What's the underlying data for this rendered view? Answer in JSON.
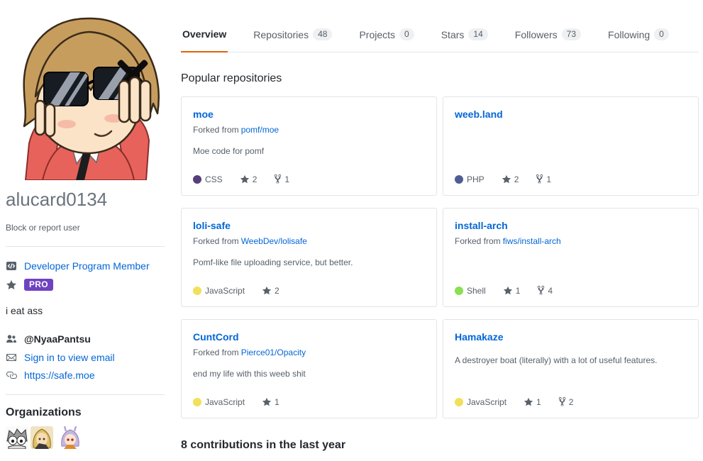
{
  "header_tabs": [
    {
      "label": "Overview",
      "count": null,
      "active": true
    },
    {
      "label": "Repositories",
      "count": "48"
    },
    {
      "label": "Projects",
      "count": "0"
    },
    {
      "label": "Stars",
      "count": "14"
    },
    {
      "label": "Followers",
      "count": "73"
    },
    {
      "label": "Following",
      "count": "0"
    }
  ],
  "sidebar": {
    "username": "alucard0134",
    "block_report_label": "Block or report user",
    "developer_program_label": "Developer Program Member",
    "pro_badge_label": "PRO",
    "bio": "i eat ass",
    "organization_handle": "@NyaaPantsu",
    "email_label": "Sign in to view email",
    "website_url": "https://safe.moe",
    "organizations_title": "Organizations"
  },
  "main": {
    "popular_repositories_title": "Popular repositories",
    "forked_from_prefix": "Forked from",
    "repositories": [
      {
        "name": "moe",
        "forked_from": "pomf/moe",
        "description": "Moe code for pomf",
        "language": "CSS",
        "language_color": "#563d7c",
        "stars": "2",
        "forks": "1"
      },
      {
        "name": "weeb.land",
        "forked_from": "",
        "description": "",
        "language": "PHP",
        "language_color": "#4F5D95",
        "stars": "2",
        "forks": "1"
      },
      {
        "name": "loli-safe",
        "forked_from": "WeebDev/lolisafe",
        "description": "Pomf-like file uploading service, but better.",
        "language": "JavaScript",
        "language_color": "#f1e05a",
        "stars": "2",
        "forks": ""
      },
      {
        "name": "install-arch",
        "forked_from": "fiws/install-arch",
        "description": "",
        "language": "Shell",
        "language_color": "#89e051",
        "stars": "1",
        "forks": "4"
      },
      {
        "name": "CuntCord",
        "forked_from": "Pierce01/Opacity",
        "description": "end my life with this weeb shit",
        "language": "JavaScript",
        "language_color": "#f1e05a",
        "stars": "1",
        "forks": ""
      },
      {
        "name": "Hamakaze",
        "forked_from": "",
        "description": "A destroyer boat (literally) with a lot of useful features.",
        "language": "JavaScript",
        "language_color": "#f1e05a",
        "stars": "1",
        "forks": "2"
      }
    ],
    "contributions_text": "8 contributions in the last year"
  },
  "icons": {
    "star": "star-icon",
    "fork": "git-fork-icon",
    "people": "people-icon",
    "mail": "mail-icon",
    "link": "link-icon",
    "developer_program": "developer-program-icon"
  },
  "colors": {
    "tab_underline_accent": "#e36209",
    "link_blue": "#0366d6",
    "pro_badge_purple": "#6f42c1",
    "counter_pill_bg": "#eef0f2",
    "card_border": "#e1e4e8"
  }
}
